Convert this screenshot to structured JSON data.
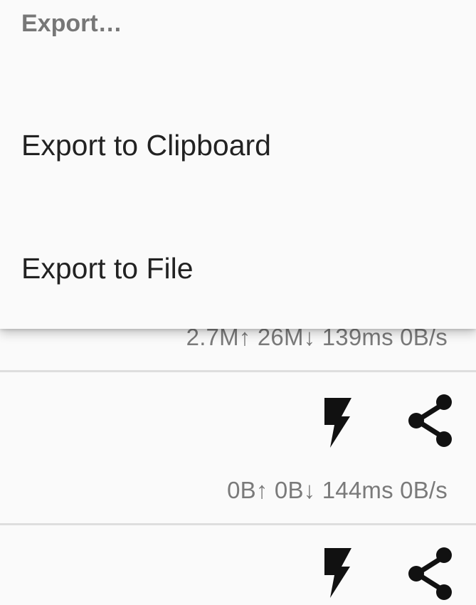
{
  "menu": {
    "header": "Export…",
    "items": [
      {
        "label": "Export to Clipboard"
      },
      {
        "label": "Export to File"
      }
    ]
  },
  "rows": [
    {
      "stats": "2.7M↑  26M↓  139ms  0B/s"
    },
    {
      "stats": "0B↑  0B↓  144ms  0B/s",
      "icons": [
        "flash-icon",
        "share-icon"
      ]
    },
    {
      "icons": [
        "flash-icon",
        "share-icon"
      ]
    }
  ],
  "colors": {
    "background": "#fafafa",
    "divider": "#dedede",
    "stats_text": "#7a7a7a",
    "menu_text": "#222222",
    "header_text": "#777777",
    "icon": "#111111"
  }
}
